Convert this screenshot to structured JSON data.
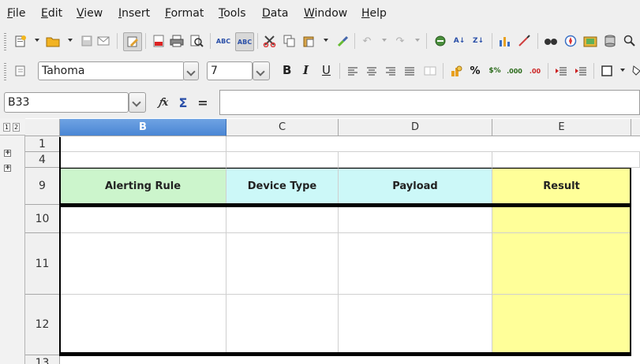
{
  "menu": [
    "File",
    "Edit",
    "View",
    "Insert",
    "Format",
    "Tools",
    "Data",
    "Window",
    "Help"
  ],
  "toolbar": {
    "font_name": "Tahoma",
    "font_size": "7",
    "bold": "B",
    "italic": "I",
    "underline": "U"
  },
  "formula_bar": {
    "name_box": "B33",
    "formula_value": ""
  },
  "outline_levels": [
    "1",
    "2"
  ],
  "columns": [
    "B",
    "C",
    "D",
    "E"
  ],
  "rows": [
    "1",
    "4",
    "9",
    "10",
    "11",
    "12",
    "13"
  ],
  "header_row": {
    "b": "Alerting Rule",
    "c": "Device Type",
    "d": "Payload",
    "e": "Result"
  },
  "colors": {
    "alerting_rule_bg": "#ccf5cc",
    "device_type_bg": "#ccf8f8",
    "payload_bg": "#ccf8f8",
    "result_bg": "#ffff99",
    "selected_col": "#4a86d4"
  }
}
